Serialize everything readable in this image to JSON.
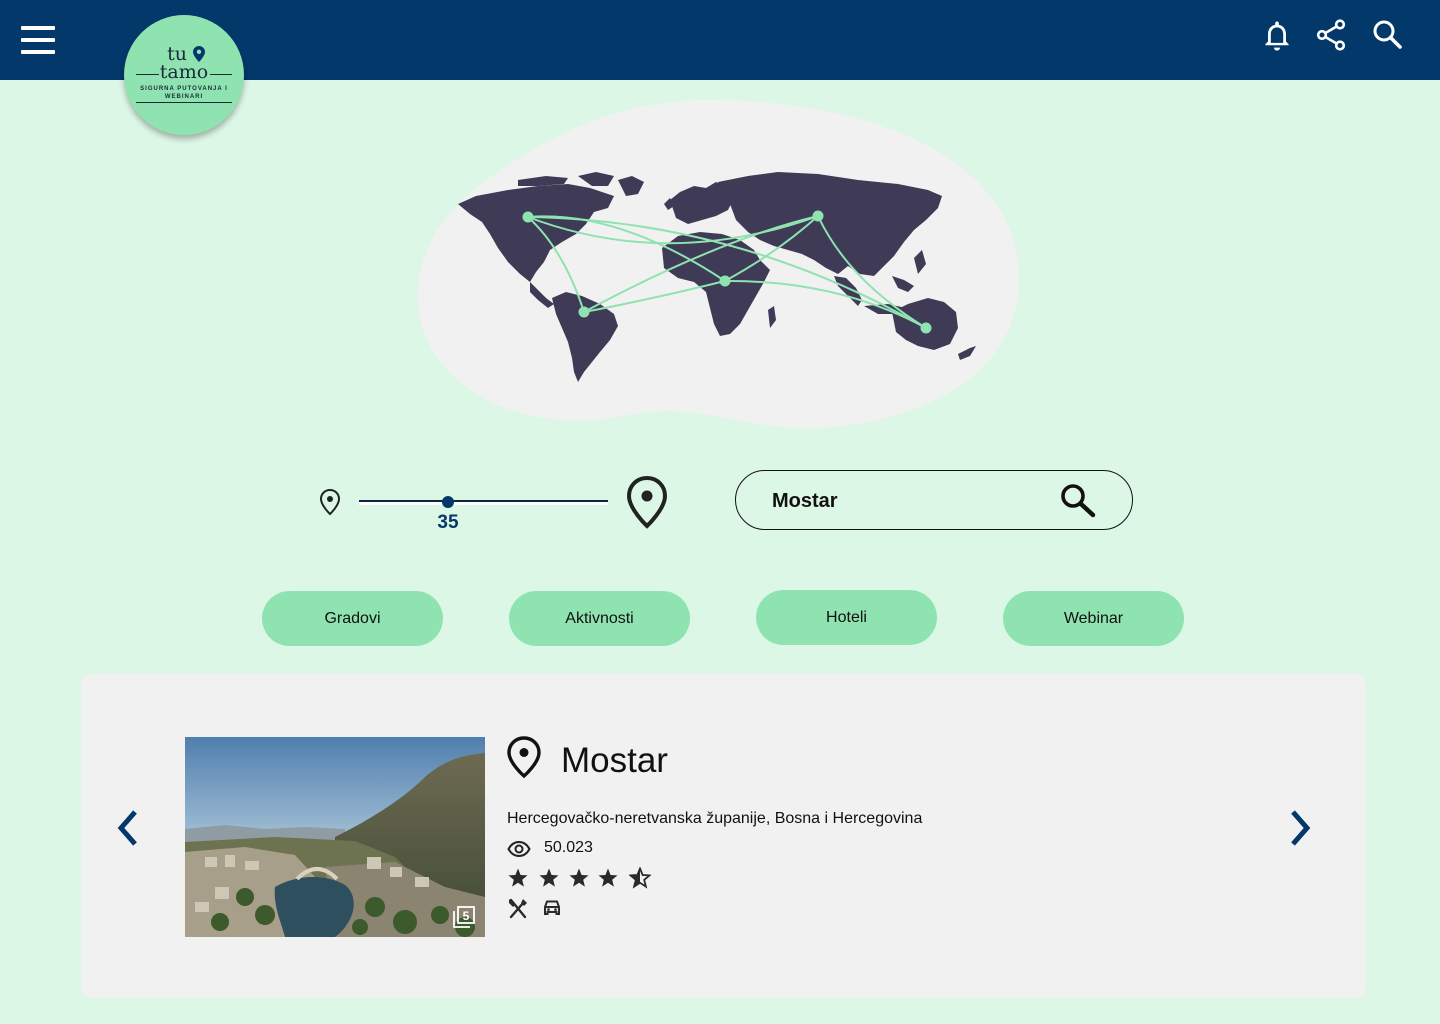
{
  "header": {
    "menu_icon": "menu-icon",
    "logo": {
      "line1": "tu",
      "line2": "tamo",
      "tagline": "SIGURNA PUTOVANJA I WEBINARI"
    },
    "actions": [
      "bell-icon",
      "share-icon",
      "search-icon"
    ]
  },
  "hero": {
    "illustration": "world-map-with-connections"
  },
  "distance": {
    "value": "35",
    "percent": 35
  },
  "search": {
    "value": "Mostar"
  },
  "categories": [
    {
      "label": "Gradovi"
    },
    {
      "label": "Aktivnosti"
    },
    {
      "label": "Hoteli"
    },
    {
      "label": "Webinar"
    }
  ],
  "result": {
    "title": "Mostar",
    "region": "Hercegovačko-neretvanska županije, Bosna i Hercegovina",
    "views": "50.023",
    "rating": 4.5,
    "gallery_count": "5",
    "amenities": [
      "restaurant-icon",
      "car-icon"
    ]
  },
  "colors": {
    "topbar": "#03386b",
    "background": "#dcf7e6",
    "accent": "#8fe3b0",
    "card": "#f1f1f1",
    "map": "#3f3a55"
  }
}
